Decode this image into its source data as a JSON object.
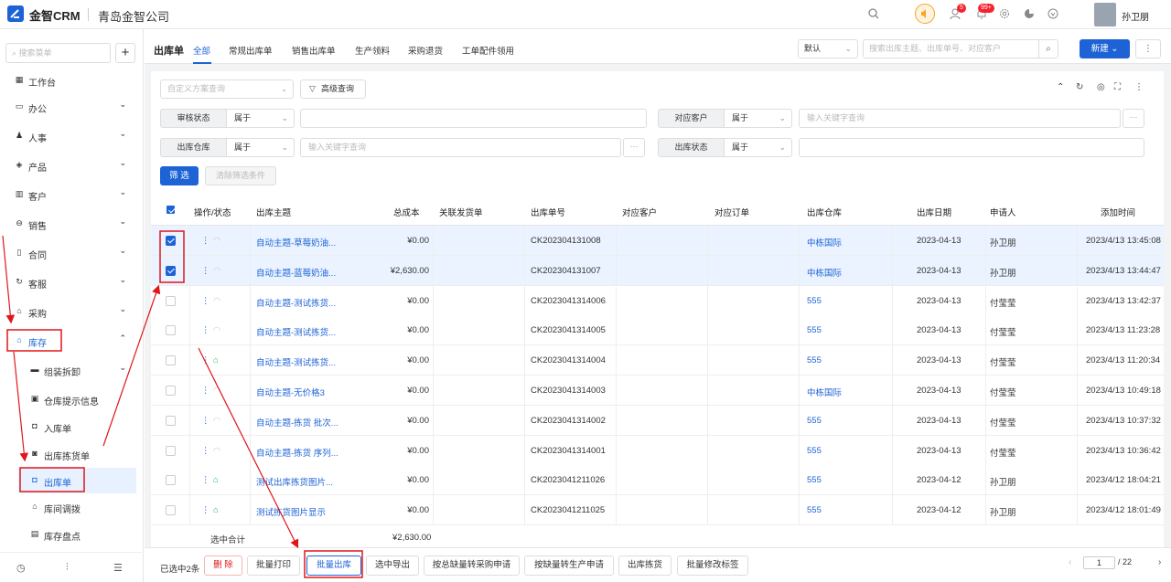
{
  "header": {
    "brand": "金智CRM",
    "company": "青岛金智公司",
    "notif_badge_1": "5",
    "notif_badge_2": "99+",
    "user": "孙卫朋"
  },
  "sidebar": {
    "search_placeholder": "搜索菜单",
    "add": "+",
    "items": [
      {
        "label": "工作台",
        "icon": "dashboard-icon"
      },
      {
        "label": "办公",
        "icon": "office-icon"
      },
      {
        "label": "人事",
        "icon": "hr-icon"
      },
      {
        "label": "产品",
        "icon": "product-icon"
      },
      {
        "label": "客户",
        "icon": "customer-icon"
      },
      {
        "label": "销售",
        "icon": "sales-icon"
      },
      {
        "label": "合同",
        "icon": "contract-icon"
      },
      {
        "label": "客服",
        "icon": "service-icon"
      },
      {
        "label": "采购",
        "icon": "purchase-icon"
      },
      {
        "label": "库存",
        "icon": "inventory-icon"
      }
    ],
    "sub_items": [
      {
        "label": "组装拆卸"
      },
      {
        "label": "仓库提示信息"
      },
      {
        "label": "入库单"
      },
      {
        "label": "出库拣货单"
      },
      {
        "label": "出库单"
      },
      {
        "label": "库间调拨"
      },
      {
        "label": "库存盘点"
      }
    ]
  },
  "tabs": {
    "title": "出库单",
    "items": [
      "全部",
      "常规出库单",
      "销售出库单",
      "生产领料",
      "采购退货",
      "工单配件领用"
    ],
    "view": "默认",
    "search_placeholder": "搜索出库主题、出库单号、对应客户",
    "new": "新建",
    "more": "⋮"
  },
  "filter": {
    "scheme_placeholder": "自定义方案查询",
    "advanced": "高级查询",
    "field1": "审核状态",
    "op1": "属于",
    "field2": "对应客户",
    "op2": "属于",
    "placeholder2": "输入关键字查询",
    "field3": "出库仓库",
    "op3": "属于",
    "placeholder3": "输入关键字查询",
    "field4": "出库状态",
    "op4": "属于",
    "dots": "···",
    "apply": "筛 选",
    "clear": "清除筛选条件"
  },
  "table": {
    "columns": [
      "操作/状态",
      "出库主题",
      "总成本",
      "关联发货单",
      "出库单号",
      "对应客户",
      "对应订单",
      "出库仓库",
      "出库日期",
      "申请人",
      "添加时间"
    ],
    "rows": [
      {
        "checked": true,
        "topic": "自动主题-草莓奶油...",
        "cost": "¥0.00",
        "no": "CK202304131008",
        "warehouse": "中栋国际",
        "date": "2023-04-13",
        "applicant": "孙卫朋",
        "added": "2023/4/13 13:45:08",
        "icon": "ghost"
      },
      {
        "checked": true,
        "topic": "自动主题-蓝莓奶油...",
        "cost": "¥2,630.00",
        "no": "CK202304131007",
        "warehouse": "中栋国际",
        "date": "2023-04-13",
        "applicant": "孙卫朋",
        "added": "2023/4/13 13:44:47",
        "icon": "ghost"
      },
      {
        "checked": false,
        "topic": "自动主题-测试拣货...",
        "cost": "¥0.00",
        "no": "CK2023041314006",
        "warehouse": "555",
        "date": "2023-04-13",
        "applicant": "付莹莹",
        "added": "2023/4/13 13:42:37",
        "icon": "ghost"
      },
      {
        "checked": false,
        "topic": "自动主题-测试拣货...",
        "cost": "¥0.00",
        "no": "CK2023041314005",
        "warehouse": "555",
        "date": "2023-04-13",
        "applicant": "付莹莹",
        "added": "2023/4/13 11:23:28",
        "icon": "ghost"
      },
      {
        "checked": false,
        "topic": "自动主题-测试拣货...",
        "cost": "¥0.00",
        "no": "CK2023041314004",
        "warehouse": "555",
        "date": "2023-04-13",
        "applicant": "付莹莹",
        "added": "2023/4/13 11:20:34",
        "icon": "green"
      },
      {
        "checked": false,
        "topic": "自动主题-无价格3",
        "cost": "¥0.00",
        "no": "CK2023041314003",
        "warehouse": "中栋国际",
        "date": "2023-04-13",
        "applicant": "付莹莹",
        "added": "2023/4/13 10:49:18",
        "icon": "ghost"
      },
      {
        "checked": false,
        "topic": "自动主题-拣货 批次...",
        "cost": "¥0.00",
        "no": "CK2023041314002",
        "warehouse": "555",
        "date": "2023-04-13",
        "applicant": "付莹莹",
        "added": "2023/4/13 10:37:32",
        "icon": "ghost"
      },
      {
        "checked": false,
        "topic": "自动主题-拣货 序列...",
        "cost": "¥0.00",
        "no": "CK2023041314001",
        "warehouse": "555",
        "date": "2023-04-13",
        "applicant": "付莹莹",
        "added": "2023/4/13 10:36:42",
        "icon": "ghost"
      },
      {
        "checked": false,
        "topic": "测试出库拣货图片...",
        "cost": "¥0.00",
        "no": "CK2023041211026",
        "warehouse": "555",
        "date": "2023-04-12",
        "applicant": "孙卫朋",
        "added": "2023/4/12 18:04:21",
        "icon": "green"
      },
      {
        "checked": false,
        "topic": "测试拣货图片显示",
        "cost": "¥0.00",
        "no": "CK2023041211025",
        "warehouse": "555",
        "date": "2023-04-12",
        "applicant": "孙卫朋",
        "added": "2023/4/12 18:01:49",
        "icon": "green"
      }
    ],
    "subtotal_label": "选中合计",
    "subtotal_value": "¥2,630.00"
  },
  "bottom": {
    "selected": "已选中2条",
    "actions": [
      "删 除",
      "批量打印",
      "批量出库",
      "选中导出",
      "按总缺量转采购申请",
      "按缺量转生产申请",
      "出库拣货",
      "批量修改标签"
    ],
    "page": "1",
    "total_pages": "/ 22"
  },
  "colors": {
    "accent": "#1e63d6",
    "annotation": "#e0161b"
  }
}
